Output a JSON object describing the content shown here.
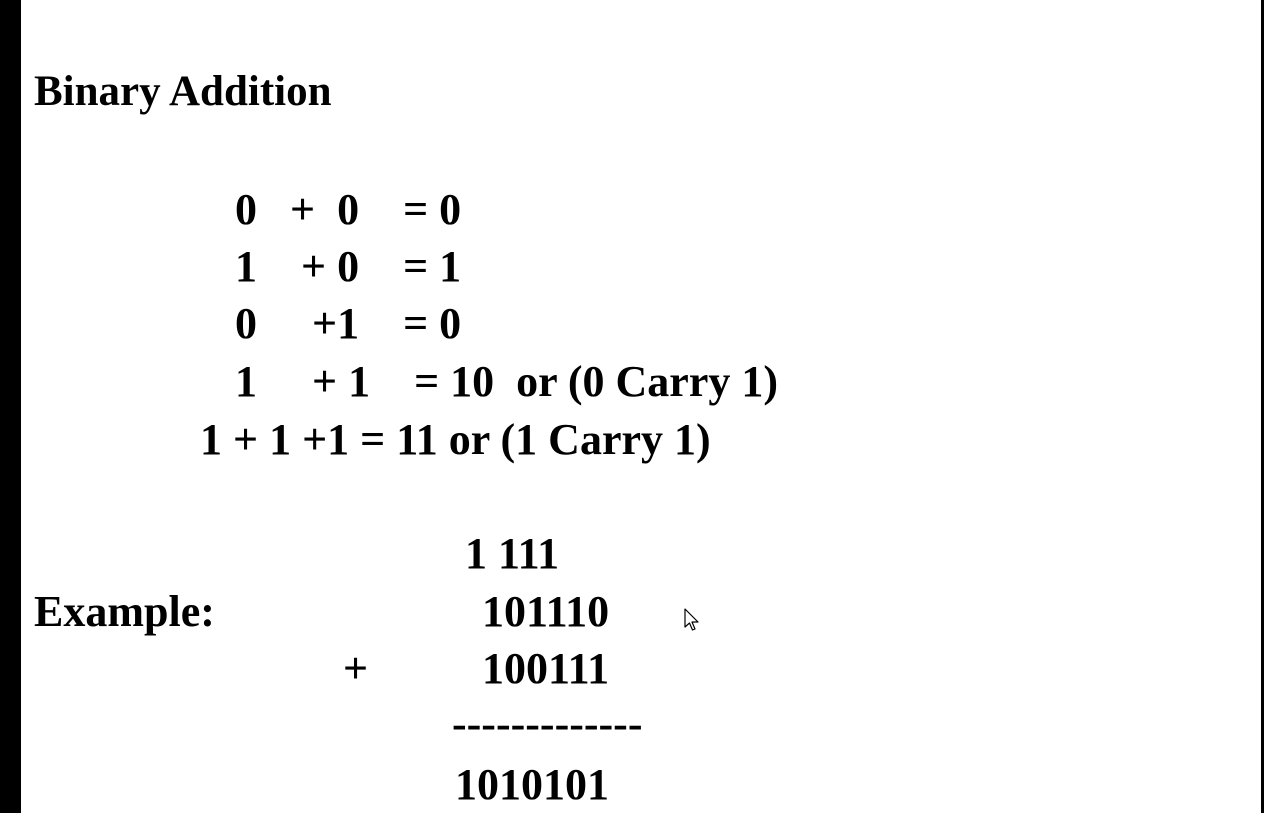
{
  "title": "Binary Addition",
  "rules": [
    "0   +  0    = 0",
    "1    + 0    = 1",
    "0     +1    = 0",
    "1     + 1    = 10  or (0 Carry 1)",
    "1 + 1 +1 = 11 or (1 Carry 1)"
  ],
  "example": {
    "label": "Example:",
    "carry_row": "1 111",
    "operand1": "101110",
    "plus_sign": "+",
    "operand2": "100111",
    "separator": "-------------",
    "result": "1010101"
  },
  "icons": {
    "cursor": "mouse-pointer-icon"
  },
  "colors": {
    "background": "#ffffff",
    "text": "#000000",
    "border": "#000000"
  }
}
